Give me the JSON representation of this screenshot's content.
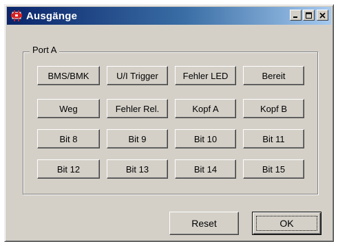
{
  "window": {
    "title": "Ausgänge",
    "icon": "red-connector-app-icon",
    "controls": [
      "minimize-icon",
      "maximize-icon",
      "close-icon"
    ]
  },
  "group": {
    "label": "Port A",
    "rows": [
      [
        "BMS/BMK",
        "U/I Trigger",
        "Fehler LED",
        "Bereit"
      ],
      [
        "Weg",
        "Fehler Rel.",
        "Kopf A",
        "Kopf B"
      ],
      [
        "Bit 8",
        "Bit 9",
        "Bit 10",
        "Bit 11"
      ],
      [
        "Bit 12",
        "Bit 13",
        "Bit 14",
        "Bit 15"
      ]
    ]
  },
  "footer": {
    "reset_label": "Reset",
    "ok_label": "OK"
  },
  "colors": {
    "face": "#d4d0c8",
    "title_start": "#0a246a",
    "title_end": "#a6caf0",
    "icon_red": "#d42020"
  }
}
